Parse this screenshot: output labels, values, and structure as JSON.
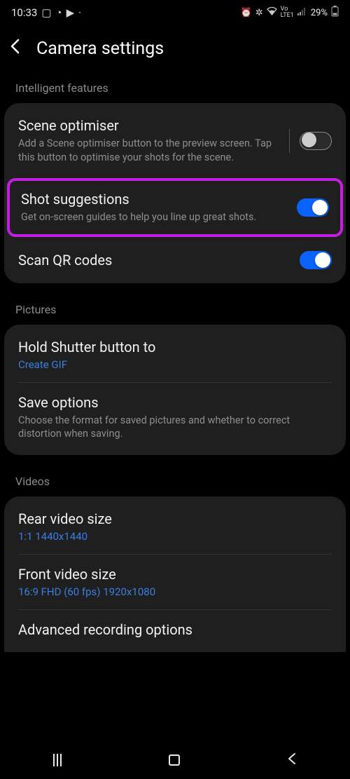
{
  "status": {
    "time": "10:33",
    "battery": "29%",
    "network_label": "LTE1",
    "carrier": "Vo"
  },
  "header": {
    "title": "Camera settings"
  },
  "sections": {
    "intelligent": {
      "label": "Intelligent features",
      "scene_optimiser": {
        "title": "Scene optimiser",
        "desc": "Add a Scene optimiser button to the preview screen. Tap this button to optimise your shots for the scene."
      },
      "shot_suggestions": {
        "title": "Shot suggestions",
        "desc": "Get on-screen guides to help you line up great shots."
      },
      "scan_qr": {
        "title": "Scan QR codes"
      }
    },
    "pictures": {
      "label": "Pictures",
      "hold_shutter": {
        "title": "Hold Shutter button to",
        "value": "Create GIF"
      },
      "save_options": {
        "title": "Save options",
        "desc": "Choose the format for saved pictures and whether to correct distortion when saving."
      }
    },
    "videos": {
      "label": "Videos",
      "rear": {
        "title": "Rear video size",
        "value": "1:1 1440x1440"
      },
      "front": {
        "title": "Front video size",
        "value": "16:9 FHD (60 fps) 1920x1080"
      },
      "advanced": {
        "title": "Advanced recording options"
      }
    }
  }
}
